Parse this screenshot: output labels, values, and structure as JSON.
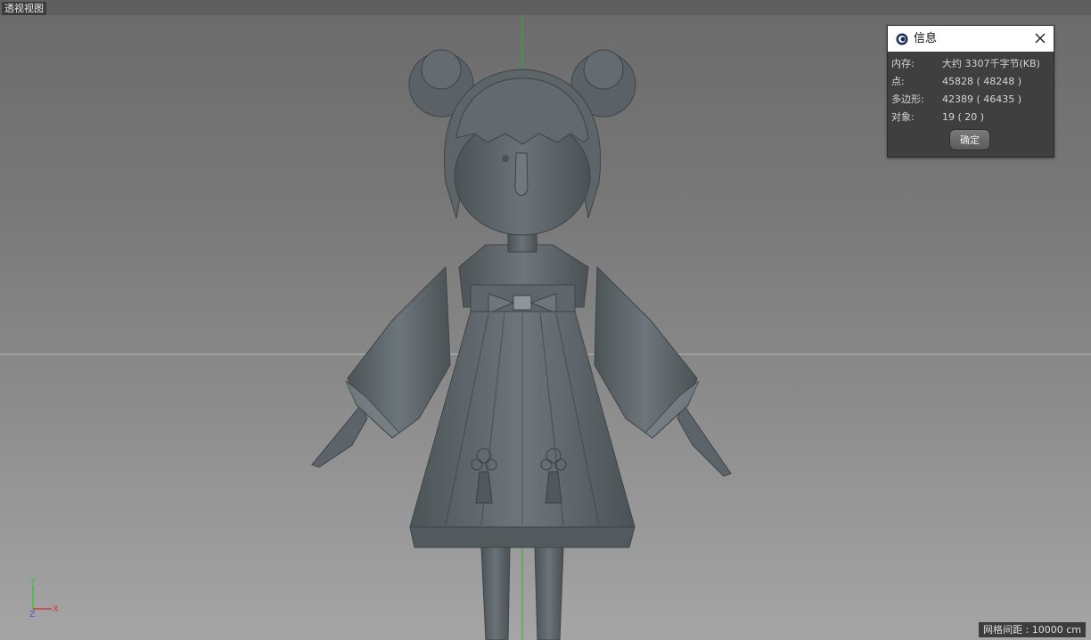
{
  "viewport": {
    "label": "透视视图",
    "grid_spacing": "网格间距 : 10000 cm",
    "axes": {
      "y": "Y",
      "z": "Z",
      "x": "X"
    }
  },
  "info_dialog": {
    "title": "信息",
    "rows": [
      {
        "label": "内存:",
        "value": "大约 3307千字节(KB)"
      },
      {
        "label": "点:",
        "value": "45828 ( 48248 )"
      },
      {
        "label": "多边形:",
        "value": "42389 ( 46435 )"
      },
      {
        "label": "对象:",
        "value": "19 ( 20 )"
      }
    ],
    "ok_label": "确定"
  },
  "colors": {
    "model": "#5f676c",
    "axis_y": "#39c239",
    "axis_x": "#d03a3a",
    "axis_z": "#4a5cd0"
  }
}
